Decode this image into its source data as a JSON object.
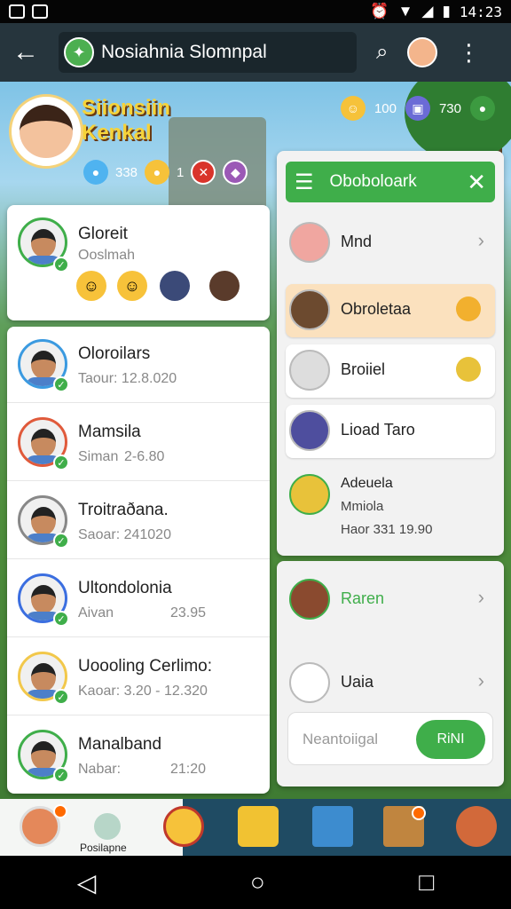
{
  "status": {
    "time": "14:23"
  },
  "appbar": {
    "title": "Nosiahnia Slomnpal"
  },
  "hud": {
    "name_line1": "Siionsiin",
    "name_line2": "Kenkal",
    "stat1": "338",
    "stat2": "1",
    "top_stat1": "100",
    "top_stat2": "730"
  },
  "featured": {
    "name": "Gloreit",
    "sub": "Ooslmah"
  },
  "contacts": [
    {
      "name": "Oloroilars",
      "sub": "Taour: 12.8.020"
    },
    {
      "name": "Mamsila",
      "sub": "Siman",
      "sub2": "2-6.80"
    },
    {
      "name": "Troitraðana.",
      "sub": "Saoar: 241020"
    },
    {
      "name": "Ultondolonia",
      "sub": "Aivan",
      "sub2": "23.95"
    },
    {
      "name": "Uoooling Cerlimo:",
      "sub": "Kaoar: 3.20 - 12.320"
    },
    {
      "name": "Manalband",
      "sub": "Nabar:",
      "sub2": "21:20"
    }
  ],
  "panel": {
    "title": "Oboboloark",
    "items": [
      {
        "label": "Mnd"
      },
      {
        "label": "Obroletaa"
      },
      {
        "label": "Broiiel"
      },
      {
        "label": "Lioad Taro"
      }
    ],
    "group": {
      "line1": "Adeuela",
      "line2": "Mmiola",
      "line3": "Haor 331 19.90"
    }
  },
  "panel2": {
    "items": [
      {
        "label": "Raren"
      },
      {
        "label": "Uaia"
      }
    ],
    "search_placeholder": "Neantoiigal",
    "search_button": "RiNI"
  },
  "bottombar": {
    "label": "Posilapne"
  },
  "colors": {
    "accent": "#3fae4a",
    "appbar": "#26353d",
    "highlight": "#fbe1be"
  }
}
